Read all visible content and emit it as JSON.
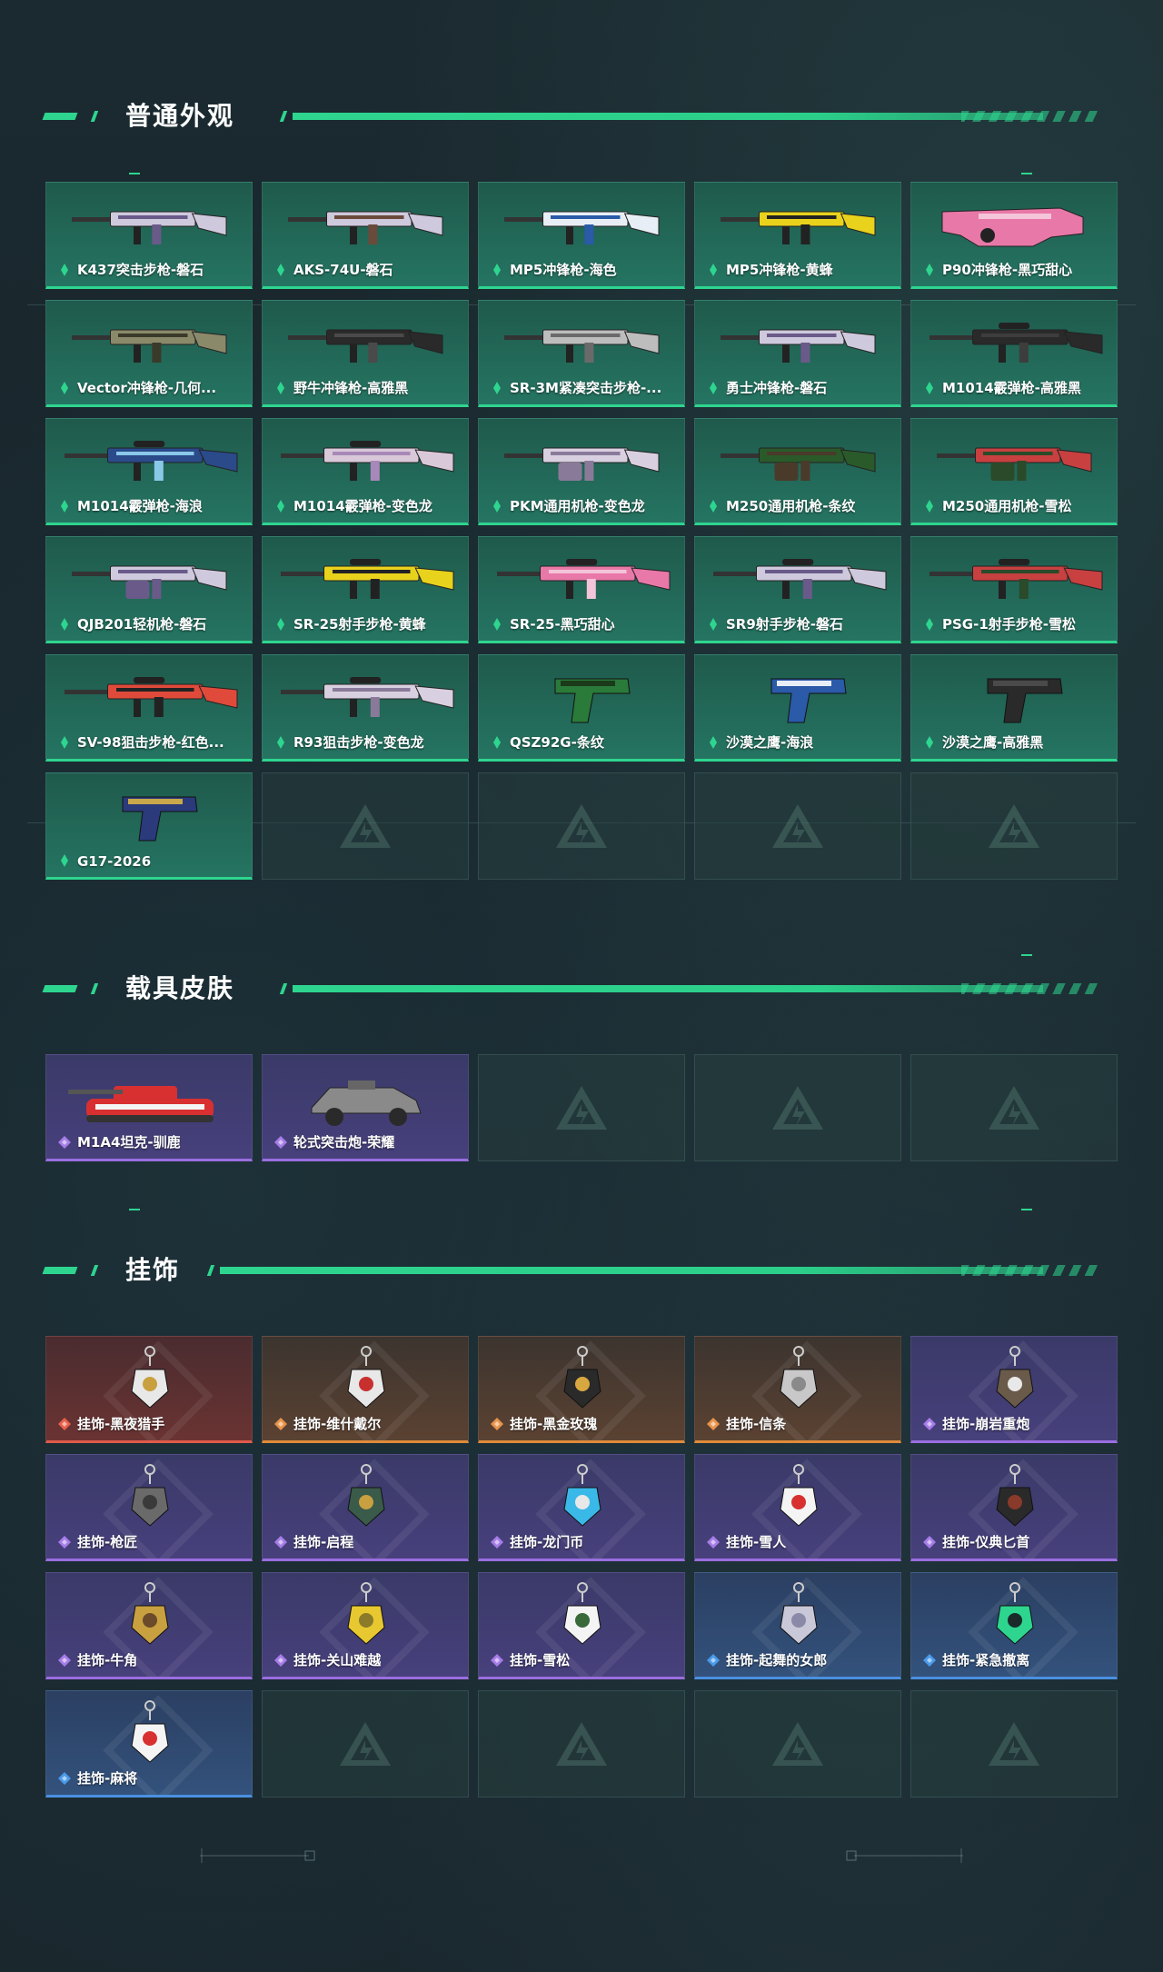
{
  "sections": {
    "weapons": {
      "title": "普通外观",
      "items": [
        {
          "label": "K437突击步枪-磐石",
          "icon": "assault-rifle-icon",
          "rarity": "green",
          "colors": [
            "#cfc9dd",
            "#6a5a8a"
          ]
        },
        {
          "label": "AKS-74U-磐石",
          "icon": "rifle-icon",
          "rarity": "green",
          "colors": [
            "#cfc9dd",
            "#6a4a3a"
          ]
        },
        {
          "label": "MP5冲锋枪-海色",
          "icon": "smg-icon",
          "rarity": "green",
          "colors": [
            "#e8eef5",
            "#2a5aa8"
          ]
        },
        {
          "label": "MP5冲锋枪-黄蜂",
          "icon": "smg-icon",
          "rarity": "green",
          "colors": [
            "#e8d21c",
            "#222222"
          ]
        },
        {
          "label": "P90冲锋枪-黑巧甜心",
          "icon": "p90-icon",
          "rarity": "green",
          "colors": [
            "#e878a8",
            "#f4c4d8"
          ]
        },
        {
          "label": "Vector冲锋枪-几何...",
          "icon": "smg-icon",
          "rarity": "green",
          "colors": [
            "#8a8a6a",
            "#3a3a2a"
          ]
        },
        {
          "label": "野牛冲锋枪-高雅黑",
          "icon": "smg-icon",
          "rarity": "green",
          "colors": [
            "#2a2a2a",
            "#4a4a4a"
          ]
        },
        {
          "label": "SR-3M紧凑突击步枪-...",
          "icon": "assault-rifle-icon",
          "rarity": "green",
          "colors": [
            "#bdbdbd",
            "#6a6a6a"
          ]
        },
        {
          "label": "勇士冲锋枪-磐石",
          "icon": "smg-icon",
          "rarity": "green",
          "colors": [
            "#cfc9dd",
            "#6a5a8a"
          ]
        },
        {
          "label": "M1014霰弹枪-高雅黑",
          "icon": "shotgun-icon",
          "rarity": "green",
          "colors": [
            "#2a2a2a",
            "#3d3d3d"
          ]
        },
        {
          "label": "M1014霰弹枪-海浪",
          "icon": "shotgun-icon",
          "rarity": "green",
          "colors": [
            "#2a4a8a",
            "#8ac8e8"
          ]
        },
        {
          "label": "M1014霰弹枪-变色龙",
          "icon": "shotgun-icon",
          "rarity": "green",
          "colors": [
            "#d8c8d8",
            "#a888b8"
          ]
        },
        {
          "label": "PKM通用机枪-变色龙",
          "icon": "machine-gun-icon",
          "rarity": "green",
          "colors": [
            "#d8d0e0",
            "#8a7a9a"
          ]
        },
        {
          "label": "M250通用机枪-条纹",
          "icon": "machine-gun-icon",
          "rarity": "green",
          "colors": [
            "#2a5a2a",
            "#4a3a2a"
          ]
        },
        {
          "label": "M250通用机枪-雪松",
          "icon": "machine-gun-icon",
          "rarity": "green",
          "colors": [
            "#c84040",
            "#2a4a2a"
          ]
        },
        {
          "label": "QJB201轻机枪-磐石",
          "icon": "machine-gun-icon",
          "rarity": "green",
          "colors": [
            "#cfc9dd",
            "#6a5a8a"
          ]
        },
        {
          "label": "SR-25射手步枪-黄蜂",
          "icon": "sniper-rifle-icon",
          "rarity": "green",
          "colors": [
            "#e8d21c",
            "#222222"
          ]
        },
        {
          "label": "SR-25-黑巧甜心",
          "icon": "sniper-rifle-icon",
          "rarity": "green",
          "colors": [
            "#e878a8",
            "#f4c4d8"
          ]
        },
        {
          "label": "SR9射手步枪-磐石",
          "icon": "sniper-rifle-icon",
          "rarity": "green",
          "colors": [
            "#cfc9dd",
            "#6a5a8a"
          ]
        },
        {
          "label": "PSG-1射手步枪-雪松",
          "icon": "sniper-rifle-icon",
          "rarity": "green",
          "colors": [
            "#c84040",
            "#2a4a2a"
          ]
        },
        {
          "label": "SV-98狙击步枪-红色...",
          "icon": "sniper-rifle-icon",
          "rarity": "green",
          "colors": [
            "#e04a3a",
            "#222222"
          ]
        },
        {
          "label": "R93狙击步枪-变色龙",
          "icon": "sniper-rifle-icon",
          "rarity": "green",
          "colors": [
            "#d8d0e0",
            "#8a7a9a"
          ]
        },
        {
          "label": "QSZ92G-条纹",
          "icon": "pistol-icon",
          "rarity": "green",
          "colors": [
            "#2a7a3a",
            "#1a3a1a"
          ]
        },
        {
          "label": "沙漠之鹰-海浪",
          "icon": "pistol-icon",
          "rarity": "green",
          "colors": [
            "#2a5aa8",
            "#e8eef5"
          ]
        },
        {
          "label": "沙漠之鹰-高雅黑",
          "icon": "pistol-icon",
          "rarity": "green",
          "colors": [
            "#2a2a2a",
            "#4a4a4a"
          ]
        },
        {
          "label": "G17-2026",
          "icon": "pistol-icon",
          "rarity": "green",
          "colors": [
            "#2a3a7a",
            "#c8a84a"
          ]
        }
      ]
    },
    "vehicles": {
      "title": "载具皮肤",
      "items": [
        {
          "label": "M1A4坦克-驯鹿",
          "icon": "tank-icon",
          "rarity": "purple",
          "colors": [
            "#d83030",
            "#f4f4f4"
          ]
        },
        {
          "label": "轮式突击炮-荣耀",
          "icon": "armored-car-icon",
          "rarity": "purple",
          "colors": [
            "#8a8a8a",
            "#2a2a2a"
          ]
        }
      ]
    },
    "charms": {
      "title": "挂饰",
      "items": [
        {
          "label": "挂饰-黑夜猎手",
          "icon": "charm-icon",
          "rarity": "red",
          "colors": [
            "#e8e8e8",
            "#c8a040"
          ]
        },
        {
          "label": "挂饰-维什戴尔",
          "icon": "charm-icon",
          "rarity": "orange",
          "colors": [
            "#e8e8e8",
            "#c83030"
          ]
        },
        {
          "label": "挂饰-黑金玫瑰",
          "icon": "charm-icon",
          "rarity": "orange",
          "colors": [
            "#2a2a2a",
            "#d8a840"
          ]
        },
        {
          "label": "挂饰-信条",
          "icon": "charm-icon",
          "rarity": "orange",
          "colors": [
            "#c8c8c8",
            "#8a8a8a"
          ]
        },
        {
          "label": "挂饰-崩岩重炮",
          "icon": "charm-icon",
          "rarity": "purple",
          "colors": [
            "#6a5a4a",
            "#e8e8e8"
          ]
        },
        {
          "label": "挂饰-枪匠",
          "icon": "charm-icon",
          "rarity": "purple",
          "colors": [
            "#6a6a6a",
            "#3a3a3a"
          ]
        },
        {
          "label": "挂饰-启程",
          "icon": "charm-icon",
          "rarity": "purple",
          "colors": [
            "#3a5a4a",
            "#c8a040"
          ]
        },
        {
          "label": "挂饰-龙门币",
          "icon": "charm-icon",
          "rarity": "purple",
          "colors": [
            "#3ab8e8",
            "#e8e8e8"
          ]
        },
        {
          "label": "挂饰-雪人",
          "icon": "charm-icon",
          "rarity": "purple",
          "colors": [
            "#f4f4f4",
            "#d83030"
          ]
        },
        {
          "label": "挂饰-仪典匕首",
          "icon": "charm-icon",
          "rarity": "purple",
          "colors": [
            "#2a2a2a",
            "#8a3a2a"
          ]
        },
        {
          "label": "挂饰-牛角",
          "icon": "charm-icon",
          "rarity": "purple",
          "colors": [
            "#c8a040",
            "#6a4a2a"
          ]
        },
        {
          "label": "挂饰-关山难越",
          "icon": "charm-icon",
          "rarity": "purple",
          "colors": [
            "#e8c830",
            "#8a7a2a"
          ]
        },
        {
          "label": "挂饰-雪松",
          "icon": "charm-icon",
          "rarity": "purple",
          "colors": [
            "#f4f4f4",
            "#3a6a3a"
          ]
        },
        {
          "label": "挂饰-起舞的女郎",
          "icon": "charm-icon",
          "rarity": "blue",
          "colors": [
            "#c8c8d8",
            "#8a8aa8"
          ]
        },
        {
          "label": "挂饰-紧急撤离",
          "icon": "charm-icon",
          "rarity": "blue",
          "colors": [
            "#2ed58f",
            "#1a2a2a"
          ]
        },
        {
          "label": "挂饰-麻将",
          "icon": "charm-icon",
          "rarity": "blue",
          "colors": [
            "#f4f4f4",
            "#d83030"
          ]
        }
      ]
    }
  },
  "accent_color": "#2ed58f"
}
